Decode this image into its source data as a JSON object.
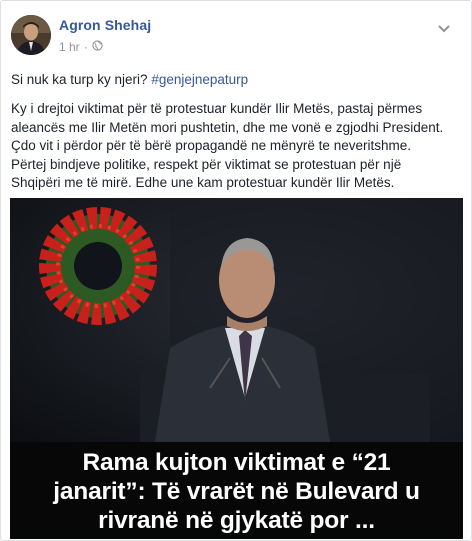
{
  "post": {
    "author": "Agron Shehaj",
    "timestamp": "1 hr",
    "separator": "·",
    "privacy_icon": "globe-icon",
    "menu_icon": "chevron-down-icon",
    "headline_text": "Si nuk ka turp ky njeri? ",
    "hashtag": "#genjejnepaturp",
    "body_lines": [
      "Ky i drejtoi viktimat për të protestuar kundër Ilir Metës, pastaj përmes",
      "aleancës me Ilir Metën mori pushtetin, dhe me vonë e zgjodhi President.",
      "Çdo vit i përdor për të bërë propagandë ne mënyrë te neveritshme.",
      "Përtej bindjeve politike, respekt për viktimat se protestuan për një",
      "Shqipëri me të mirë. Edhe une kam protestuar kundër Ilir Metës."
    ]
  },
  "image": {
    "caption_lines": [
      "Rama kujton viktimat e “21",
      "janarit”: Të vrarët në Bulevard u",
      "rivranë në gjykatë por ..."
    ]
  },
  "colors": {
    "link": "#365899",
    "meta": "#90949c",
    "text": "#1d2129",
    "wreath_red": "#c8211b",
    "wreath_green": "#2d5a22"
  }
}
